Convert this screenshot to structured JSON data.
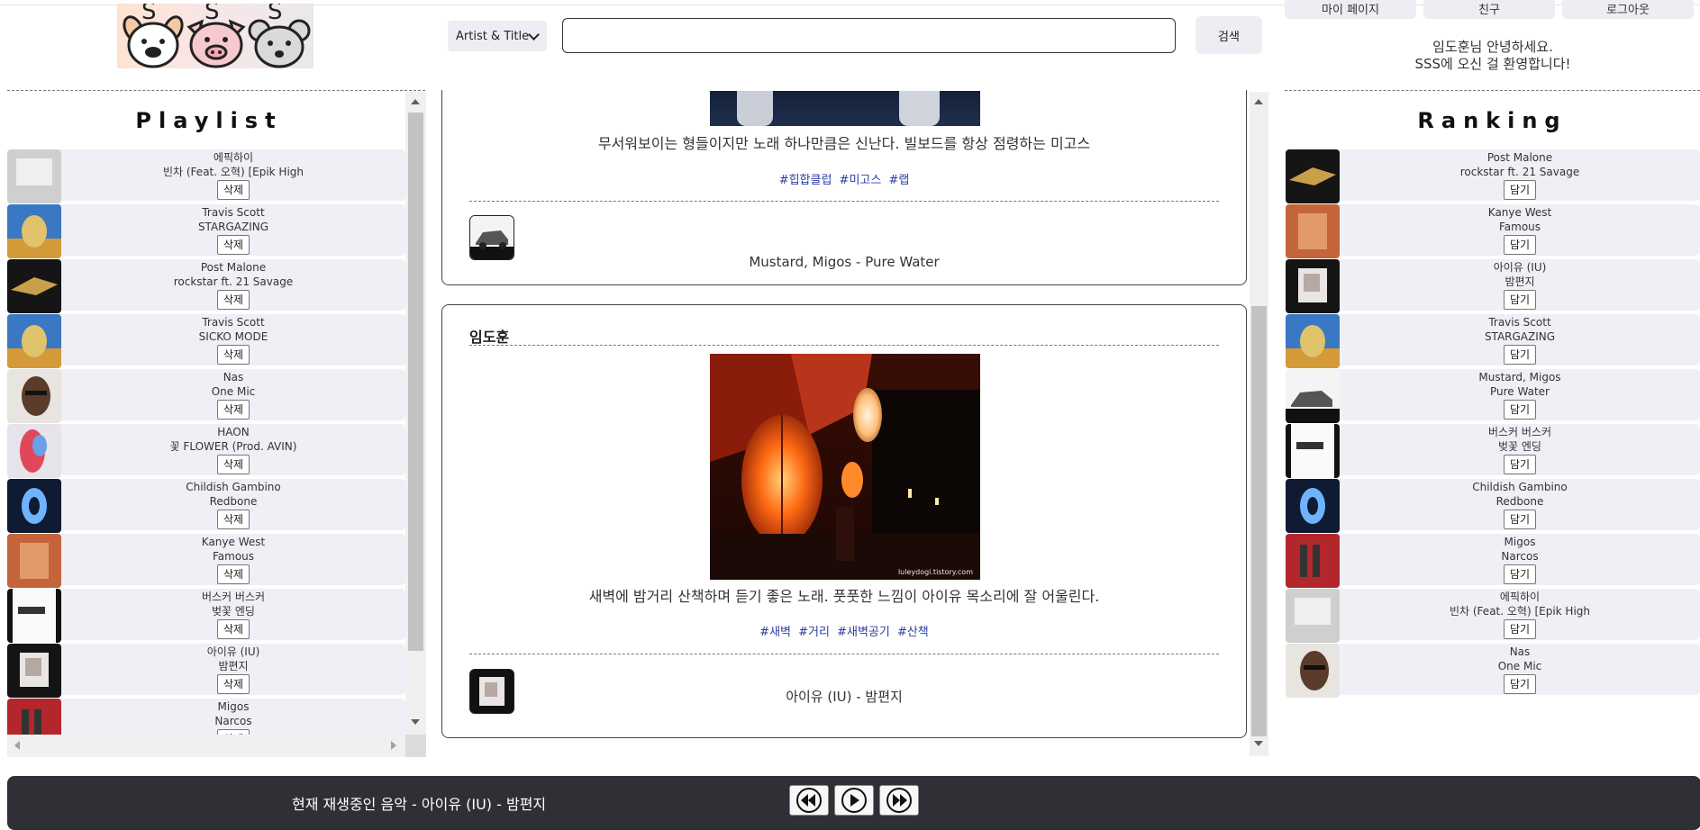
{
  "header": {
    "logo_letters": [
      "S",
      "S",
      "S"
    ],
    "search_type": "Artist & Title",
    "search_query": "",
    "search_button": "검색",
    "nav": [
      "마이 페이지",
      "친구",
      "로그아웃"
    ],
    "greeting_line1": "임도훈님 안녕하세요.",
    "greeting_line2": "SSS에 오신 걸 환영합니다!"
  },
  "playlist": {
    "title": "Playlist",
    "items": [
      {
        "artist": "에픽하이",
        "title": "빈차 (Feat. 오혁) [Epik High",
        "button": "삭제",
        "cover": "gray"
      },
      {
        "artist": "Travis Scott",
        "title": "STARGAZING",
        "button": "삭제",
        "cover": "astro"
      },
      {
        "artist": "Post Malone",
        "title": "rockstar ft. 21 Savage",
        "button": "삭제",
        "cover": "gold"
      },
      {
        "artist": "Travis Scott",
        "title": "SICKO MODE",
        "button": "삭제",
        "cover": "astro"
      },
      {
        "artist": "Nas",
        "title": "One Mic",
        "button": "삭제",
        "cover": "face"
      },
      {
        "artist": "HAON",
        "title": "꽃 FLOWER (Prod. AVIN)",
        "button": "삭제",
        "cover": "red"
      },
      {
        "artist": "Childish Gambino",
        "title": "Redbone",
        "button": "삭제",
        "cover": "blue"
      },
      {
        "artist": "Kanye West",
        "title": "Famous",
        "button": "삭제",
        "cover": "orange"
      },
      {
        "artist": "버스커 버스커",
        "title": "벚꽃 엔딩",
        "button": "삭제",
        "cover": "white"
      },
      {
        "artist": "아이유 (IU)",
        "title": "밤편지",
        "button": "삭제",
        "cover": "dark"
      },
      {
        "artist": "Migos",
        "title": "Narcos",
        "button": "삭제",
        "cover": "crimson"
      }
    ]
  },
  "ranking": {
    "title": "Ranking",
    "items": [
      {
        "artist": "Post Malone",
        "title": "rockstar ft. 21 Savage",
        "button": "담기",
        "cover": "gold"
      },
      {
        "artist": "Kanye West",
        "title": "Famous",
        "button": "담기",
        "cover": "orange"
      },
      {
        "artist": "아이유 (IU)",
        "title": "밤편지",
        "button": "담기",
        "cover": "dark"
      },
      {
        "artist": "Travis Scott",
        "title": "STARGAZING",
        "button": "담기",
        "cover": "astro"
      },
      {
        "artist": "Mustard, Migos",
        "title": "Pure Water",
        "button": "담기",
        "cover": "car"
      },
      {
        "artist": "버스커 버스커",
        "title": "벚꽃 엔딩",
        "button": "담기",
        "cover": "white"
      },
      {
        "artist": "Childish Gambino",
        "title": "Redbone",
        "button": "담기",
        "cover": "blue"
      },
      {
        "artist": "Migos",
        "title": "Narcos",
        "button": "담기",
        "cover": "crimson"
      },
      {
        "artist": "에픽하이",
        "title": "빈차 (Feat. 오혁) [Epik High",
        "button": "담기",
        "cover": "gray"
      },
      {
        "artist": "Nas",
        "title": "One Mic",
        "button": "담기",
        "cover": "face"
      }
    ]
  },
  "feed": {
    "posts": [
      {
        "description": "무서워보이는 형들이지만 노래 하나만큼은 신난다. 빌보드를 항상 점령하는 미고스",
        "tags": "#힙합클럽 #미고스 #랩",
        "song": "Mustard, Migos  -  Pure Water"
      },
      {
        "author": "임도훈",
        "image_watermark": "luleydogi.tistory.com",
        "description": "새벽에 밤거리 산책하며 듣기 좋은 노래. 풋풋한 느낌이 아이유 목소리에 잘 어울린다.",
        "tags": "#새벽 #거리 #새벽공기 #산책",
        "song": "아이유 (IU)  -  밤편지"
      }
    ]
  },
  "player": {
    "now_playing": "현재 재생중인 음악 - 아이유 (IU) - 밤편지",
    "controls": [
      "rewind-icon",
      "play-icon",
      "fast-forward-icon"
    ]
  },
  "colors": {
    "accent_tag": "#2d3ea3",
    "row_bg": "#eef0f6",
    "player_bg": "#2f3035"
  }
}
